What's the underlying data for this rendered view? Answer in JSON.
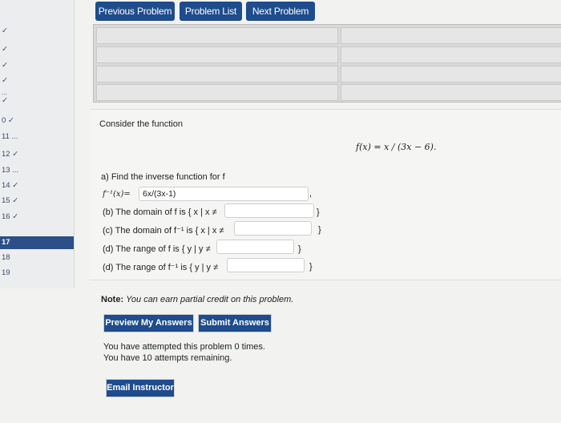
{
  "sidebar": {
    "items": [
      {
        "label": "✓"
      },
      {
        "label": "✓"
      },
      {
        "label": "✓"
      },
      {
        "label": "✓"
      },
      {
        "label": "..."
      },
      {
        "label": "✓"
      },
      {
        "label": "0 ✓"
      },
      {
        "label": "11 ..."
      },
      {
        "label": "12 ✓"
      },
      {
        "label": "13 ..."
      },
      {
        "label": "14 ✓"
      },
      {
        "label": "15 ✓"
      },
      {
        "label": "16 ✓"
      },
      {
        "label": "17"
      },
      {
        "label": "18"
      },
      {
        "label": "19"
      }
    ]
  },
  "nav": {
    "previous_label": "Previous Problem",
    "list_label": "Problem List",
    "next_label": "Next Problem"
  },
  "problem": {
    "intro": "Consider the function",
    "function_display": "f(x) = x / (3x − 6).",
    "part_a_label": "a) Find the inverse function for f",
    "part_a_prefix": "f⁻¹(x)=",
    "part_a_answer": "6x/(3x-1)",
    "part_b_label": "(b) The domain of f is { x | x ≠",
    "part_c_label": "(c) The domain of f⁻¹ is { x | x ≠",
    "part_d1_label": "(d) The range of f is { y | y ≠",
    "part_d2_label": "(d) The range of f⁻¹ is { y | y ≠",
    "close_brace": "}",
    "comma": ","
  },
  "note": {
    "bold": "Note:",
    "text": "You can earn partial credit on this problem."
  },
  "buttons": {
    "preview": "Preview My Answers",
    "submit": "Submit Answers",
    "email": "Email Instructor"
  },
  "attempts": {
    "line1": "You have attempted this problem 0 times.",
    "line2": "You have 10 attempts remaining."
  },
  "colors": {
    "accent": "#1e4c8c",
    "active_sidebar": "#2b4f86"
  }
}
